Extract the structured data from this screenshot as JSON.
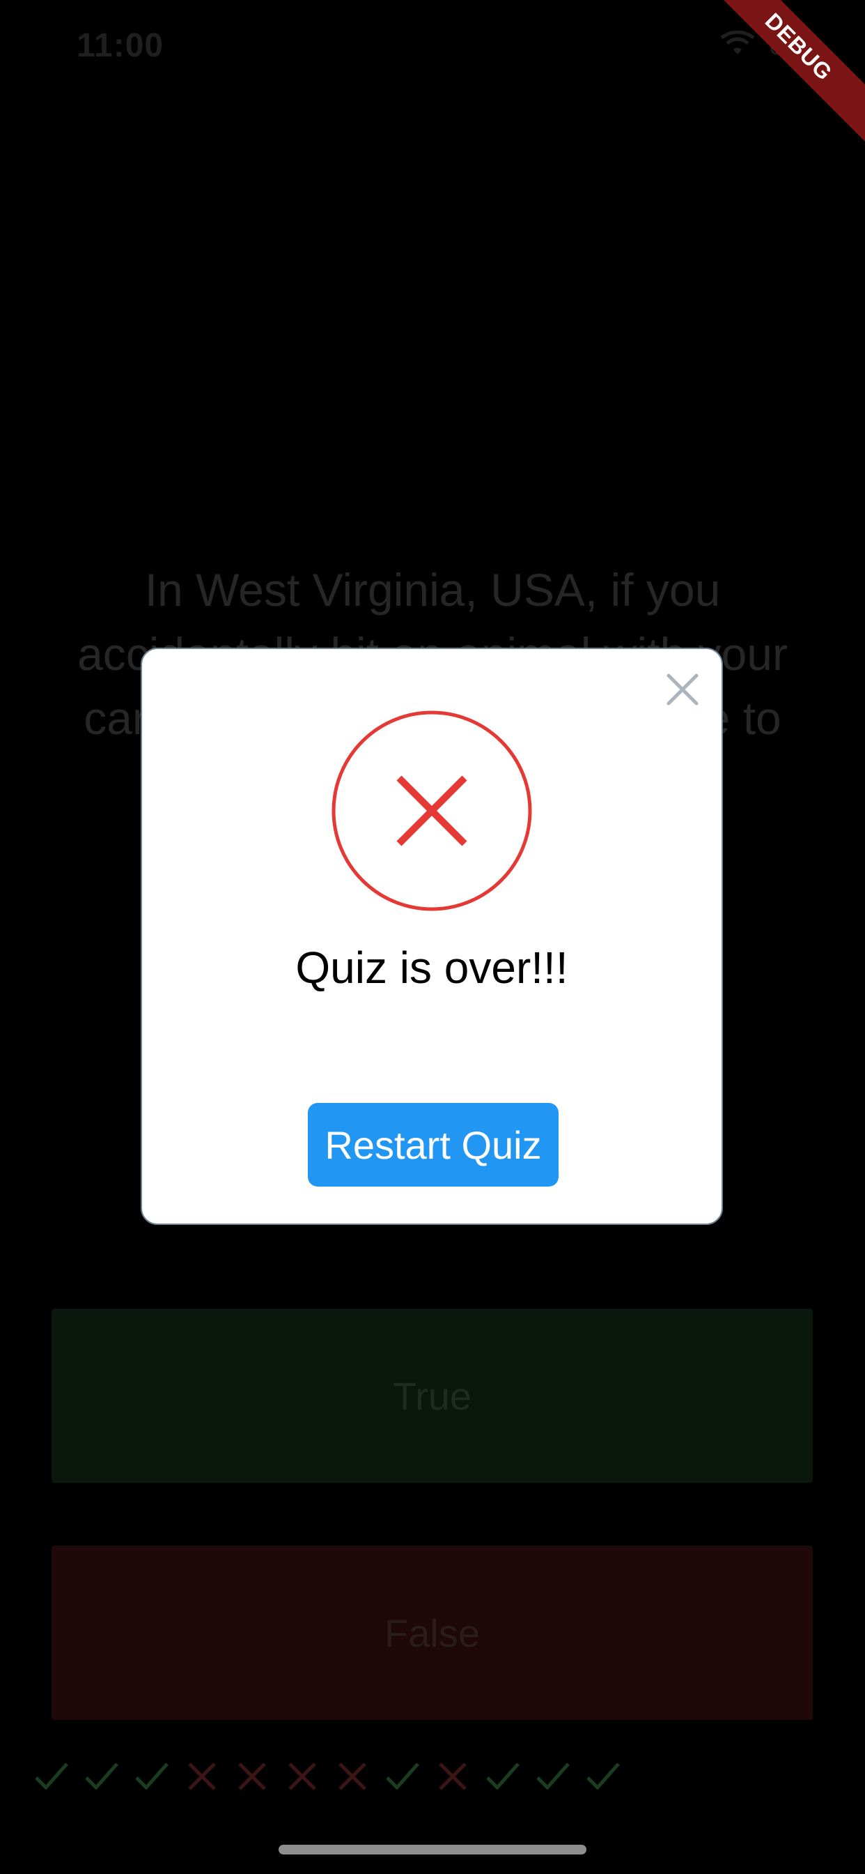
{
  "status_bar": {
    "time": "11:00",
    "icons": [
      "wifi-icon",
      "battery-icon"
    ]
  },
  "debug_banner": {
    "label": "DEBUG",
    "color": "#7b1414"
  },
  "question": {
    "text": "In West Virginia, USA, if you accidentally hit an animal with your car, you are free to take it home to eat."
  },
  "answers": {
    "true_label": "True",
    "false_label": "False",
    "true_color": "#4caf50",
    "false_color": "#f44336"
  },
  "score_keeper": {
    "marks": [
      "check",
      "check",
      "check",
      "cross",
      "cross",
      "cross",
      "cross",
      "check",
      "cross",
      "check",
      "check",
      "check"
    ],
    "check_color": "#1a3d1f",
    "cross_color": "#3d1416"
  },
  "dialog": {
    "title": "Quiz is over!!!",
    "icon": "error-x-icon",
    "icon_color": "#e53935",
    "button_label": "Restart Quiz",
    "button_color": "#2196f3",
    "close_icon": "close-icon"
  }
}
